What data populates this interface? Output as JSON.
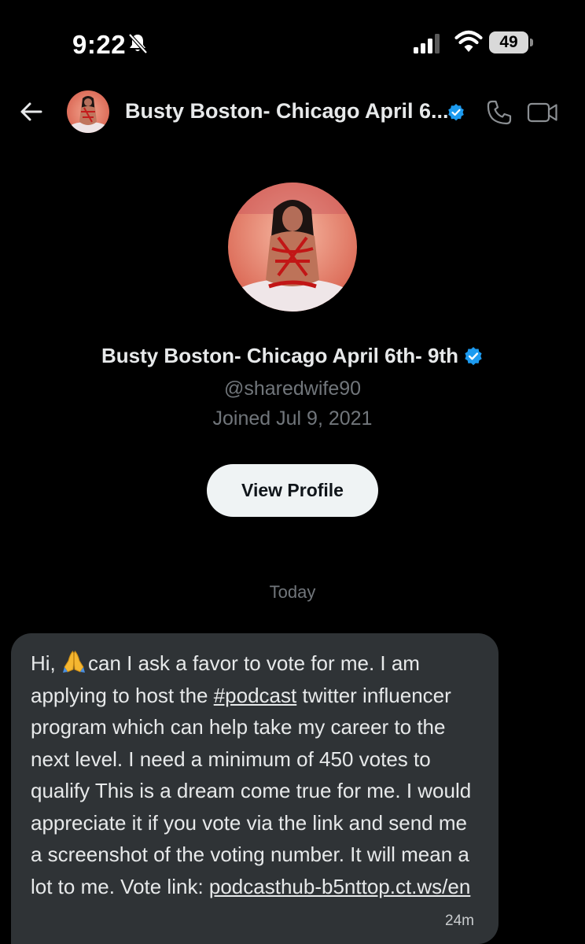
{
  "status_bar": {
    "time": "9:22",
    "battery": "49",
    "icons": [
      "bell-slash-icon",
      "signal-icon",
      "wifi-icon",
      "battery-icon"
    ]
  },
  "header": {
    "title": "Busty Boston- Chicago April 6...",
    "icons": [
      "back-arrow-icon",
      "verified-badge-icon",
      "phone-icon",
      "video-camera-icon"
    ]
  },
  "profile": {
    "name": "Busty Boston- Chicago April 6th- 9th",
    "handle": "@sharedwife90",
    "joined": "Joined Jul 9, 2021",
    "view_profile_label": "View Profile"
  },
  "conversation": {
    "day_label": "Today",
    "message": {
      "part1": "Hi, ",
      "part2": "can I ask a favor to vote for me. I am applying to host the ",
      "hashtag": "#podcast",
      "part3": "  twitter influencer program which can help take my career to the next level. I need a minimum of 450 votes to qualify This is a dream come true for me. I would appreciate it if you vote via the link and send me a screenshot of the voting number. It will mean a lot to me. Vote link: ",
      "link": "podcasthub-b5nttop.ct.ws/en",
      "time": "24m"
    }
  },
  "colors": {
    "background": "#000000",
    "bubble": "#2f3336",
    "verified": "#1d9bf0",
    "secondary_text": "#71767b"
  }
}
